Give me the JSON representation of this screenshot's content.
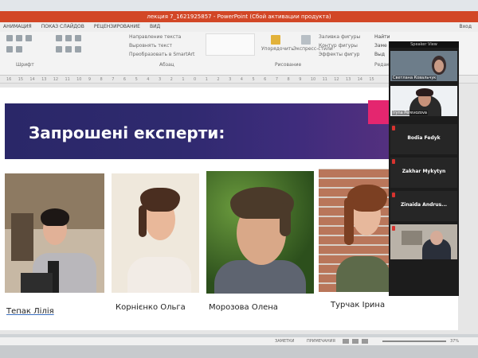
{
  "window": {
    "title": "лекция 7_1621925857  -  PowerPoint (Сбой активации продукта)"
  },
  "tabs": [
    "АНИМАЦИЯ",
    "ПОКАЗ СЛАЙДОВ",
    "РЕЦЕНЗИРОВАНИЕ",
    "ВИД"
  ],
  "tabs_right": "Вход",
  "ribbon": {
    "direction_label": "Направление текста",
    "align_label": "Выровнять текст",
    "smartart_label": "Преобразовать в SmartArt",
    "arrange_label": "Упорядочить",
    "quick_styles_label": "Экспресс-стили",
    "fill_label": "Заливка фигуры",
    "outline_label": "Контур фигуры",
    "effects_label": "Эффекты фигур",
    "find_label": "Найти",
    "replace_label": "Заме",
    "select_label": "Выд",
    "font_group": "Шрифт",
    "paragraph_group": "Абзац",
    "drawing_group": "Рисование",
    "edit_group": "Редак"
  },
  "ruler": [
    "16",
    "15",
    "14",
    "13",
    "12",
    "11",
    "10",
    "9",
    "8",
    "7",
    "6",
    "5",
    "4",
    "3",
    "2",
    "1",
    "0",
    "1",
    "2",
    "3",
    "4",
    "5",
    "6",
    "7",
    "8",
    "9",
    "10",
    "11",
    "12",
    "13",
    "14",
    "15"
  ],
  "slide": {
    "title": "Запрошені експерти",
    "title_suffix": ":",
    "experts": [
      {
        "name": "Тепак Лілія"
      },
      {
        "name": "Корнієнко Ольга"
      },
      {
        "name": "Морозова Олена"
      },
      {
        "name": "Турчак Ірина"
      }
    ]
  },
  "zoom": {
    "header": "Speaker View",
    "participants": [
      {
        "name": "Светлана Ковальчук",
        "video": true
      },
      {
        "name": "Iryna Perevozova",
        "video": true
      },
      {
        "name": "Bodia Fedyk",
        "video": false
      },
      {
        "name": "Zakhar Mykytyn",
        "video": false
      },
      {
        "name": "Zinaida  Andrus...",
        "video": false
      },
      {
        "name": "",
        "video": true
      }
    ]
  },
  "statusbar": {
    "notes_label": "ЗАМЕТКИ",
    "comments_label": "ПРИМЕЧАНИЯ",
    "zoom_value": "37%"
  },
  "colors": {
    "accent": "#d24726",
    "banner_start": "#2a2768",
    "banner_end": "#54307f",
    "pink": "#e4266f"
  }
}
